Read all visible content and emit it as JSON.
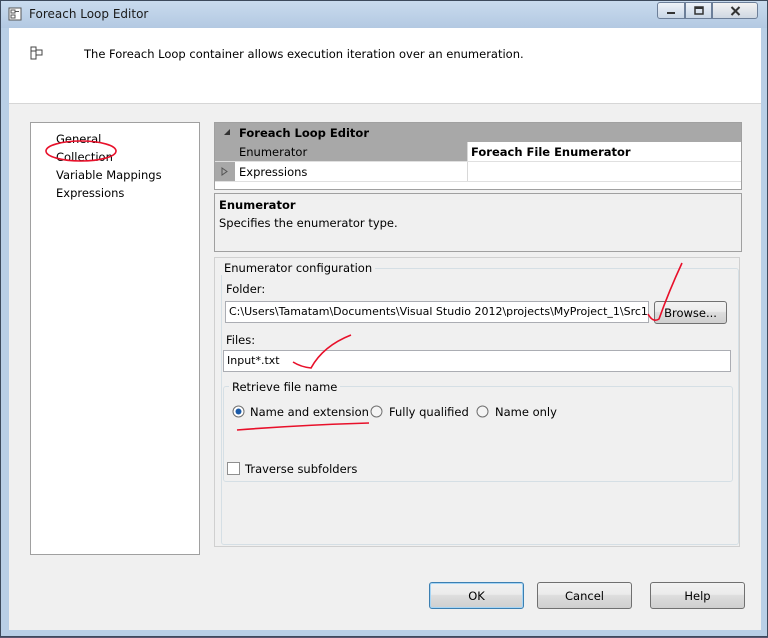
{
  "window": {
    "title": "Foreach Loop Editor",
    "controls": [
      "minimize-icon",
      "maximize-icon",
      "close-icon"
    ]
  },
  "header": {
    "description": "The Foreach Loop container allows execution iteration over an enumeration."
  },
  "nav": {
    "items": [
      {
        "label": "General",
        "selected": false
      },
      {
        "label": "Collection",
        "selected": true
      },
      {
        "label": "Variable Mappings",
        "selected": false
      },
      {
        "label": "Expressions",
        "selected": false
      }
    ]
  },
  "property_grid": {
    "category": "Foreach Loop Editor",
    "rows": [
      {
        "name": "Enumerator",
        "value": "Foreach File Enumerator"
      },
      {
        "name": "Expressions",
        "value": ""
      }
    ]
  },
  "description_panel": {
    "title": "Enumerator",
    "text": "Specifies the enumerator type."
  },
  "enumerator_config": {
    "group_label": "Enumerator configuration",
    "folder_label": "Folder:",
    "folder_value": "C:\\Users\\Tamatam\\Documents\\Visual Studio 2012\\projects\\MyProject_1\\Src1",
    "browse_label": "Browse...",
    "files_label": "Files:",
    "files_value": "Input*.txt",
    "retrieve_label": "Retrieve file name",
    "options": [
      {
        "label": "Name and extension",
        "checked": true
      },
      {
        "label": "Fully qualified",
        "checked": false
      },
      {
        "label": "Name only",
        "checked": false
      }
    ],
    "traverse_label": "Traverse subfolders",
    "traverse_checked": false
  },
  "buttons": {
    "ok": "OK",
    "cancel": "Cancel",
    "help": "Help"
  },
  "colors": {
    "annotation_ink": "#e8102a",
    "grid_header": "#a8a8a8"
  }
}
